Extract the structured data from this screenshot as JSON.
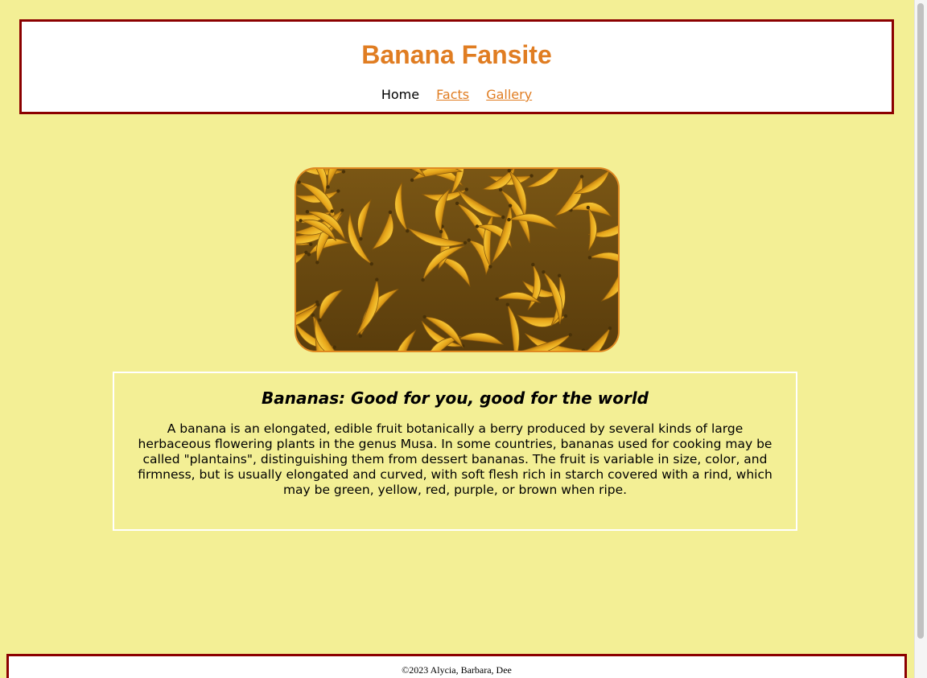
{
  "header": {
    "title": "Banana Fansite",
    "nav": [
      {
        "label": "Home",
        "current": true
      },
      {
        "label": "Facts",
        "current": false
      },
      {
        "label": "Gallery",
        "current": false
      }
    ]
  },
  "hero": {
    "image": "bananas-photo"
  },
  "article": {
    "heading": "Bananas: Good for you, good for the world",
    "body": "A banana is an elongated, edible fruit botanically a berry produced by several kinds of large herbaceous flowering plants in the genus Musa. In some countries, bananas used for cooking may be called \"plantains\", distinguishing them from dessert bananas. The fruit is variable in size, color, and firmness, but is usually elongated and curved, with soft flesh rich in starch covered with a rind, which may be green, yellow, red, purple, or brown when ripe."
  },
  "footer": {
    "text": "©2023 Alycia, Barbara, Dee"
  },
  "colors": {
    "page_background": "#f3ef95",
    "accent": "#e07d22",
    "border": "#8b0000"
  }
}
